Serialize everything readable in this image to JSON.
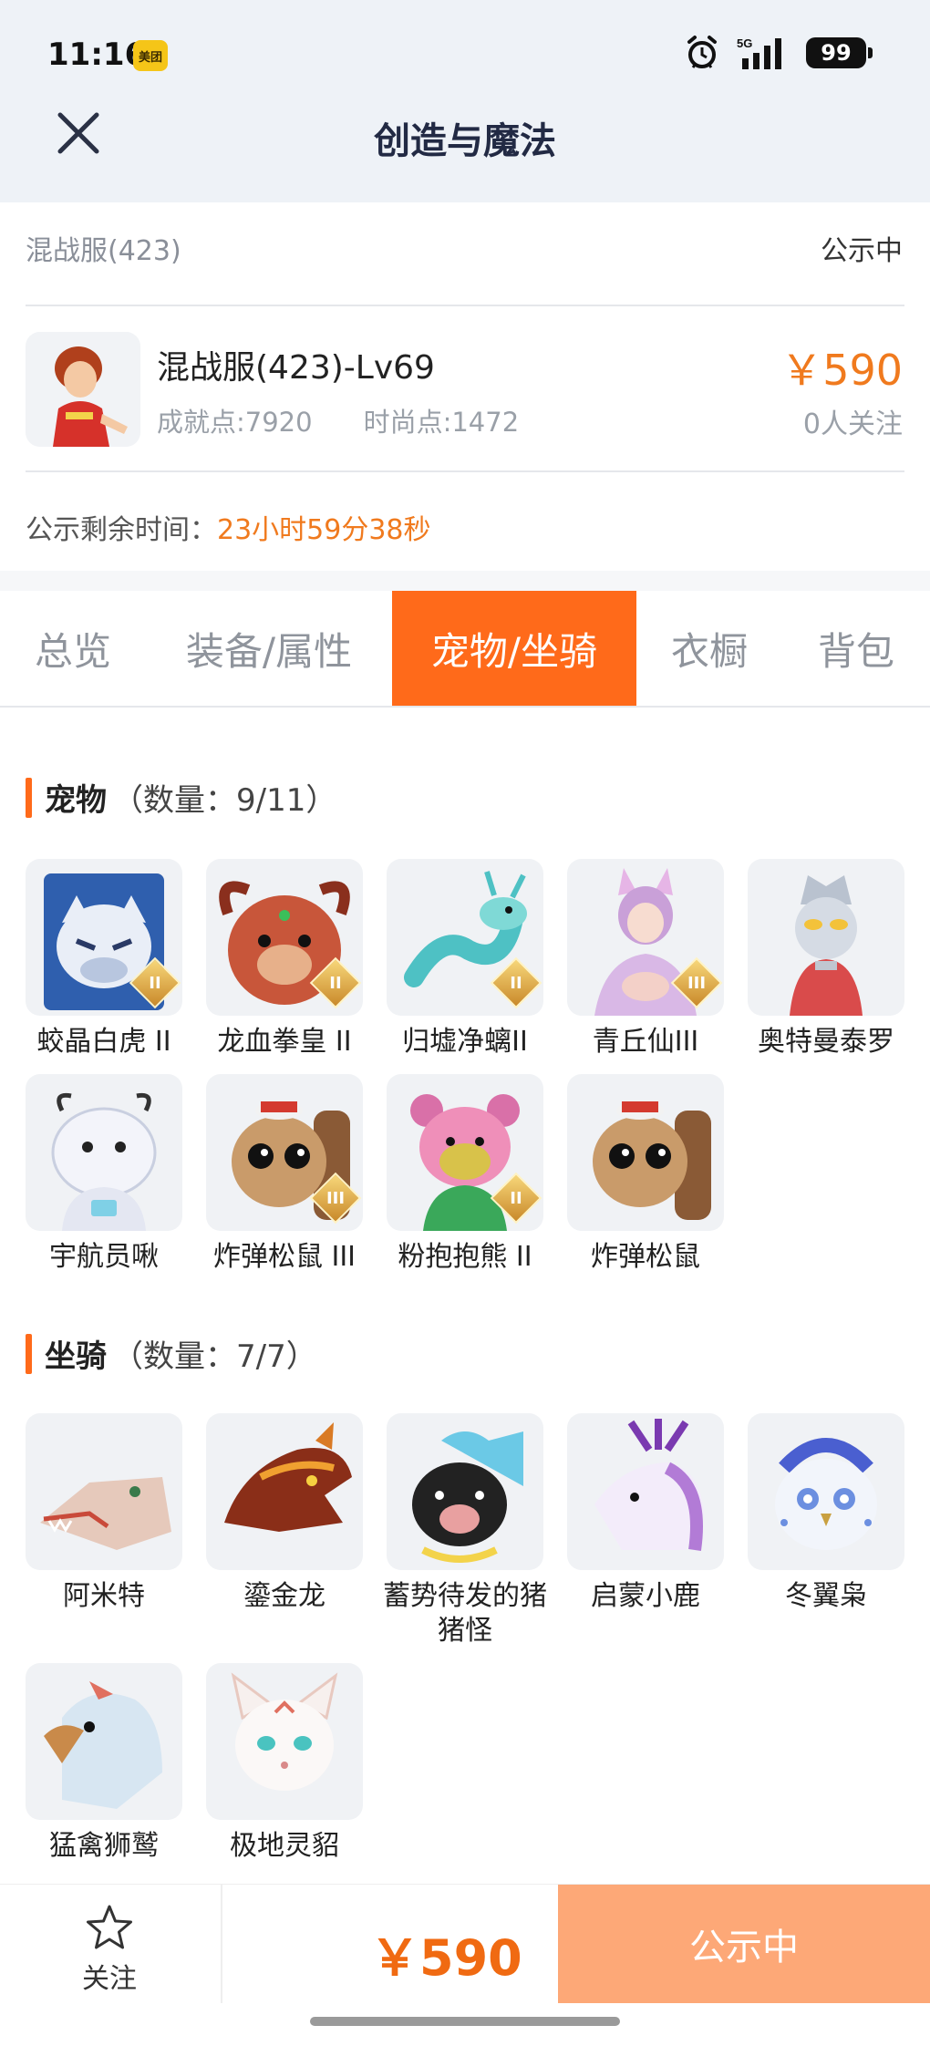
{
  "status_bar": {
    "time": "11:16",
    "app_badge": "美团",
    "network": "5G",
    "battery": "99"
  },
  "nav": {
    "title": "创造与魔法"
  },
  "info": {
    "server": "混战服(423)",
    "status": "公示中",
    "character_name": "混战服(423)-Lv69",
    "achievement": "成就点:7920",
    "fashion": "时尚点:1472",
    "price": "￥590",
    "followers": "0人关注",
    "remaining_label": "公示剩余时间：",
    "remaining_value": "23小时59分38秒"
  },
  "tabs": [
    {
      "label": "总览",
      "active": false
    },
    {
      "label": "装备/属性",
      "active": false
    },
    {
      "label": "宠物/坐骑",
      "active": true
    },
    {
      "label": "衣橱",
      "active": false
    },
    {
      "label": "背包",
      "active": false
    }
  ],
  "pets": {
    "title": "宠物",
    "count": "（数量：9/11）",
    "items": [
      {
        "name": "蛟晶白虎 II",
        "rank": "II",
        "icon": "white-tiger",
        "color": "#4a7fc9"
      },
      {
        "name": "龙血拳皇 II",
        "rank": "II",
        "icon": "dragon-boxer",
        "color": "#c8563a"
      },
      {
        "name": "归墟净螭II",
        "rank": "II",
        "icon": "jade-serpent",
        "color": "#4ec1c4"
      },
      {
        "name": "青丘仙III",
        "rank": "III",
        "icon": "fox-fairy",
        "color": "#d8a8d9"
      },
      {
        "name": "奥特曼泰罗",
        "rank": "",
        "icon": "ultraman-taro",
        "color": "#d94b4b"
      },
      {
        "name": "宇航员啾",
        "rank": "",
        "icon": "astronaut",
        "color": "#c9cfe0"
      },
      {
        "name": "炸弹松鼠 III",
        "rank": "III",
        "icon": "bomb-squirrel",
        "color": "#b98a5c"
      },
      {
        "name": "粉抱抱熊 II",
        "rank": "II",
        "icon": "pink-bear",
        "color": "#ef8fb9"
      },
      {
        "name": "炸弹松鼠",
        "rank": "",
        "icon": "bomb-squirrel",
        "color": "#b98a5c"
      }
    ]
  },
  "mounts": {
    "title": "坐骑",
    "count": "（数量：7/7）",
    "items": [
      {
        "name": "阿米特",
        "icon": "crocodile",
        "color": "#d9b8a8"
      },
      {
        "name": "鎏金龙",
        "icon": "golden-dragon",
        "color": "#a8421e"
      },
      {
        "name": "蓄势待发的猪猪怪",
        "icon": "pig-monster",
        "color": "#2b2b2b"
      },
      {
        "name": "启蒙小鹿",
        "icon": "deer",
        "color": "#b27bd6"
      },
      {
        "name": "冬翼枭",
        "icon": "snow-owl",
        "color": "#6c8fe0"
      },
      {
        "name": "猛禽狮鹫",
        "icon": "griffin",
        "color": "#b9d3e6"
      },
      {
        "name": "极地灵貂",
        "icon": "polar-marten",
        "color": "#e8c9c0"
      }
    ]
  },
  "bottom": {
    "follow_label": "关注",
    "price": "￥590",
    "cta": "公示中"
  }
}
